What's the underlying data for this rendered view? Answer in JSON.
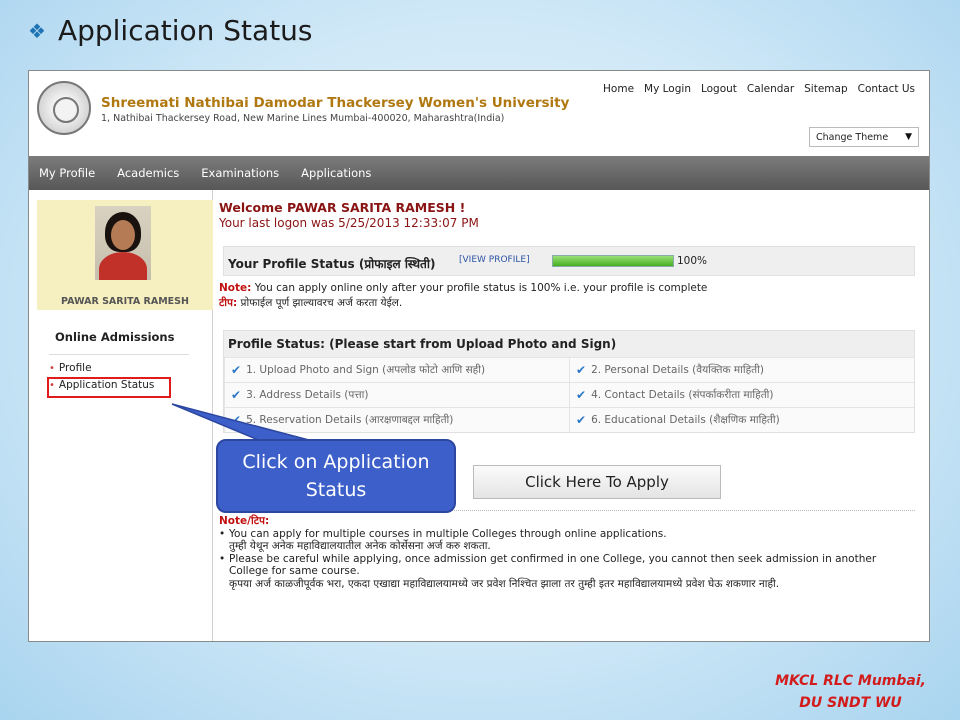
{
  "slide": {
    "title": "Application Status",
    "footer_line1": "MKCL RLC Mumbai,",
    "footer_line2": "DU SNDT WU"
  },
  "header": {
    "university_name": "Shreemati Nathibai Damodar Thackersey Women's University",
    "address": "1, Nathibai Thackersey Road, New Marine Lines Mumbai-400020, Maharashtra(India)",
    "links": [
      "Home",
      "My Login",
      "Logout",
      "Calendar",
      "Sitemap",
      "Contact Us"
    ],
    "theme_select": "Change Theme"
  },
  "nav": [
    "My Profile",
    "Academics",
    "Examinations",
    "Applications"
  ],
  "sidebar": {
    "student_name": "PAWAR SARITA RAMESH",
    "section_title": "Online Admissions",
    "items": [
      "Profile",
      "Application Status"
    ]
  },
  "main": {
    "welcome": "Welcome PAWAR SARITA RAMESH !",
    "last_logon": "Your last logon was 5/25/2013 12:33:07 PM",
    "profile_status_title": "Your Profile Status (प्रोफाइल स्थिती)",
    "view_profile": "[VIEW PROFILE]",
    "progress_percent": 100,
    "progress_text": "100%",
    "note_label": "Note:",
    "note_text": "You can apply online only after your profile status is 100% i.e. your profile is complete",
    "tip_label": "टीप:",
    "tip_text": "प्रोफाईल पूर्ण झाल्यावरच अर्ज करता येईल.",
    "ps_header": "Profile Status: (Please start from Upload Photo and Sign)",
    "ps_items": [
      "1. Upload Photo and Sign (अपलोड फोटो आणि सही)",
      "2. Personal Details (वैयक्तिक माहिती)",
      "3. Address Details (पत्ता)",
      "4. Contact Details (संपर्काकरीता माहिती)",
      "5. Reservation Details (आरक्षणाबद्दल माहिती)",
      "6. Educational Details (शैक्षणिक माहिती)"
    ],
    "apply_button": "Click Here To Apply",
    "bottom_note_title": "Note/टिप:",
    "bottom_note_lines": [
      "You can apply for multiple courses in multiple Colleges through online applications.",
      "तुम्ही येथून अनेक महाविद्यालयातील अनेक कोर्सेसना अर्ज करु शकता.",
      "Please be careful while applying, once admission get confirmed in one College, you cannot then seek admission in another College for same course.",
      "कृपया अर्ज काळजीपूर्वक भरा, एकदा एखाद्या महाविद्यालयामध्ये जर प्रवेश निश्चित झाला तर तुम्ही इतर महाविद्यालयामध्ये प्रवेश घेऊ शकणार नाही."
    ]
  },
  "callout": {
    "line1": "Click on Application",
    "line2": "Status"
  }
}
